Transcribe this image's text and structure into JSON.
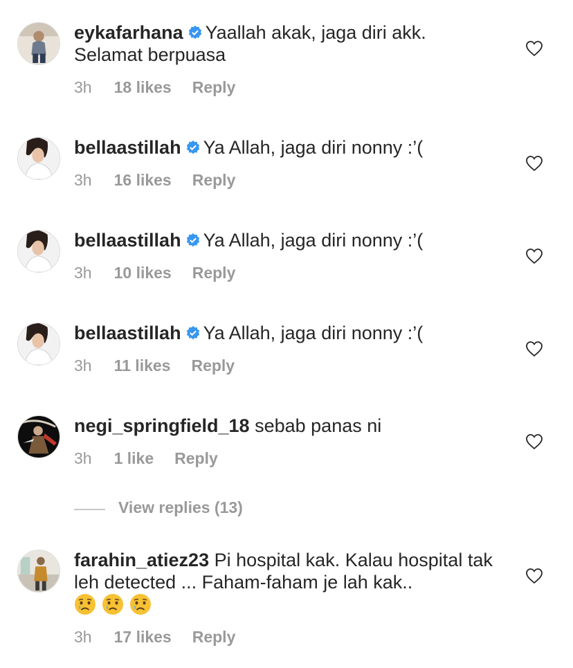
{
  "colors": {
    "text": "#262626",
    "meta": "#999999",
    "verified_badge": "#3897f0",
    "emoji": "#f7c134"
  },
  "comments": [
    {
      "username": "eykafarhana",
      "verified": true,
      "text": "Yaallah akak, jaga diri akk. Selamat berpuasa",
      "time": "3h",
      "likes": "18 likes",
      "reply": "Reply"
    },
    {
      "username": "bellaastillah",
      "verified": true,
      "text": "Ya Allah, jaga diri nonny :’(",
      "time": "3h",
      "likes": "16 likes",
      "reply": "Reply"
    },
    {
      "username": "bellaastillah",
      "verified": true,
      "text": "Ya Allah, jaga diri nonny :’(",
      "time": "3h",
      "likes": "10 likes",
      "reply": "Reply"
    },
    {
      "username": "bellaastillah",
      "verified": true,
      "text": "Ya Allah, jaga diri nonny :’(",
      "time": "3h",
      "likes": "11 likes",
      "reply": "Reply"
    },
    {
      "username": "negi_springfield_18",
      "verified": false,
      "text": "sebab panas ni",
      "time": "3h",
      "likes": "1 like",
      "reply": "Reply"
    },
    {
      "username": "farahin_atiez23",
      "verified": false,
      "text": "Pi hospital kak. Kalau hospital tak leh detected ... Faham-faham je lah kak..",
      "emojis": [
        "sad-relieved-face",
        "sad-relieved-face",
        "sad-relieved-face"
      ],
      "time": "3h",
      "likes": "17 likes",
      "reply": "Reply"
    }
  ],
  "view_replies": "View replies (13)",
  "icons": {
    "verified": "verified-badge-icon",
    "like": "heart-outline-icon"
  }
}
